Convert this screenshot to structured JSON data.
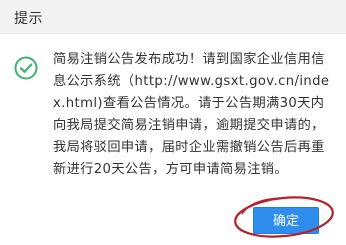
{
  "dialog": {
    "title": "提示",
    "icon": "success-check-icon",
    "message": "简易注销公告发布成功！请到国家企业信用信息公示系统（http://www.gsxt.gov.cn/index.html)查看公告情况。请于公告期满30天内向我局提交简易注销申请，逾期提交申请的，我局将驳回申请，届时企业需撤销公告后再重新进行20天公告，方可申请简易注销。",
    "confirm_label": "确定"
  },
  "colors": {
    "success": "#3cb371",
    "primary_button": "#2e8ded",
    "annotation_circle": "#b5232a"
  }
}
